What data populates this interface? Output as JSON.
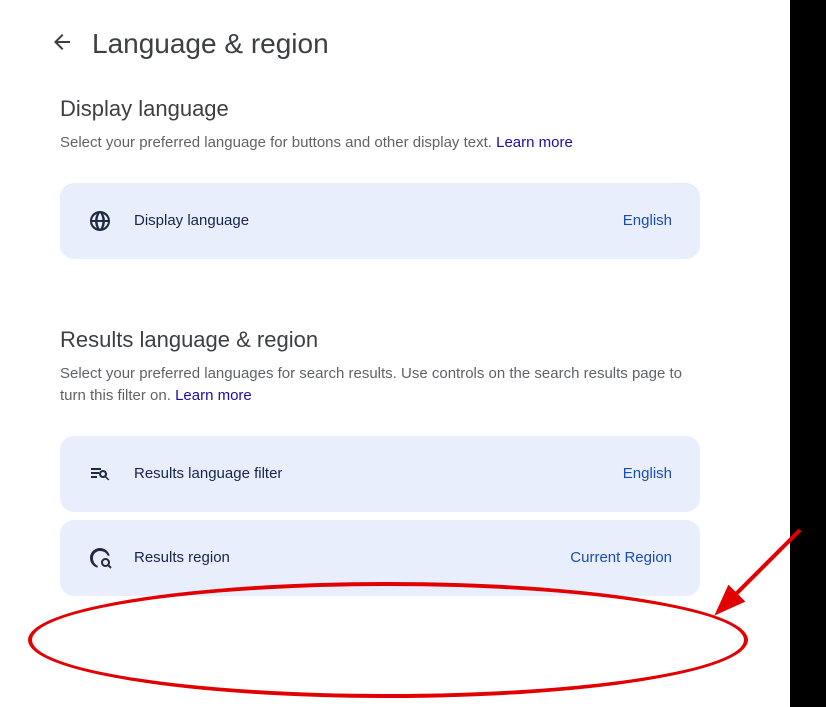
{
  "header": {
    "title": "Language & region"
  },
  "sections": {
    "display_language": {
      "title": "Display language",
      "description": "Select your preferred language for buttons and other display text. ",
      "learn_more_label": "Learn more",
      "card": {
        "label": "Display language",
        "value": "English"
      }
    },
    "results_language_region": {
      "title": "Results language & region",
      "description": "Select your preferred languages for search results. Use controls on the search results page to turn this filter on. ",
      "learn_more_label": "Learn more",
      "filter_card": {
        "label": "Results language filter",
        "value": "English"
      },
      "region_card": {
        "label": "Results region",
        "value": "Current Region"
      }
    }
  }
}
